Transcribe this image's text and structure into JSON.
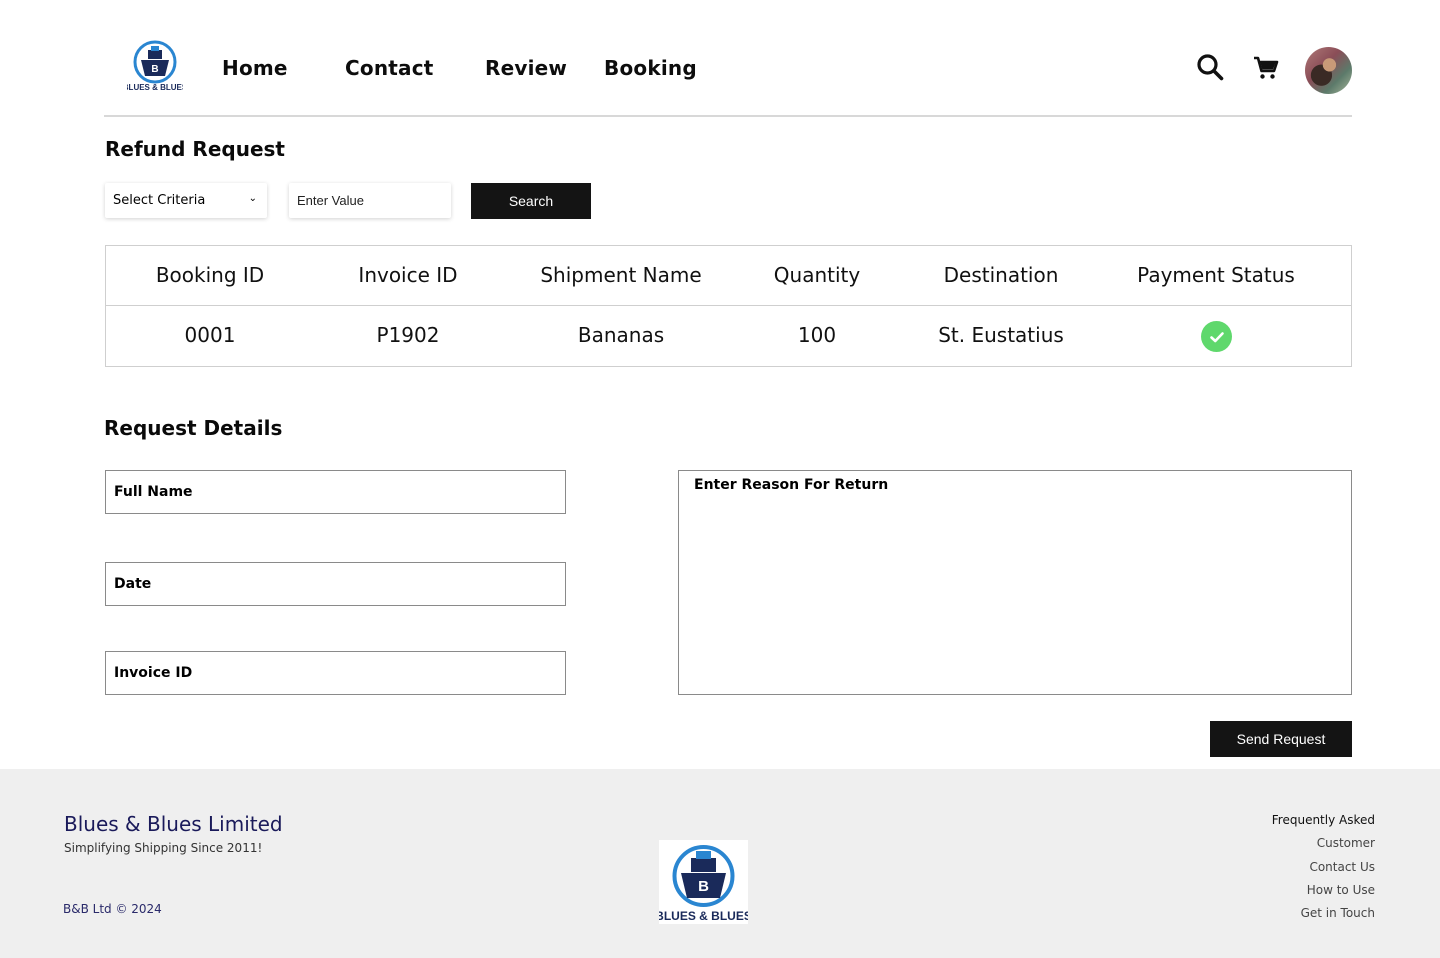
{
  "header": {
    "logo_text": "BLUES & BLUES",
    "nav": [
      "Home",
      "Contact",
      "Review",
      "Booking"
    ]
  },
  "refund": {
    "title": "Refund Request",
    "criteria_placeholder": "Select Criteria",
    "value_placeholder": "Enter Value",
    "search_label": "Search"
  },
  "table": {
    "headers": [
      "Booking ID",
      "Invoice ID",
      "Shipment Name",
      "Quantity",
      "Destination",
      "Payment Status"
    ],
    "rows": [
      {
        "booking_id": "0001",
        "invoice_id": "P1902",
        "shipment_name": "Bananas",
        "quantity": "100",
        "destination": "St. Eustatius",
        "payment_status": "paid"
      }
    ]
  },
  "details": {
    "title": "Request Details",
    "full_name_placeholder": "Full Name",
    "date_placeholder": "Date",
    "invoice_placeholder": "Invoice ID",
    "reason_placeholder": "Enter Reason For Return",
    "send_label": "Send Request"
  },
  "footer": {
    "company_name": "Blues & Blues Limited",
    "tagline": "Simplifying Shipping Since 2011!",
    "copyright": "B&B Ltd © 2024",
    "logo_text": "BLUES & BLUES",
    "links": [
      "Frequently Asked",
      "Customer",
      "Contact Us",
      "How to Use",
      "Get in Touch"
    ]
  },
  "colors": {
    "accent_dark": "#141414",
    "status_ok": "#5fd86c",
    "footer_bg": "#efefef",
    "brand_navy": "#1a1a5a",
    "brand_blue": "#2a86d1"
  },
  "icons": [
    "ship-logo-icon",
    "search-icon",
    "cart-icon",
    "chevron-down-icon",
    "check-circle-icon"
  ]
}
